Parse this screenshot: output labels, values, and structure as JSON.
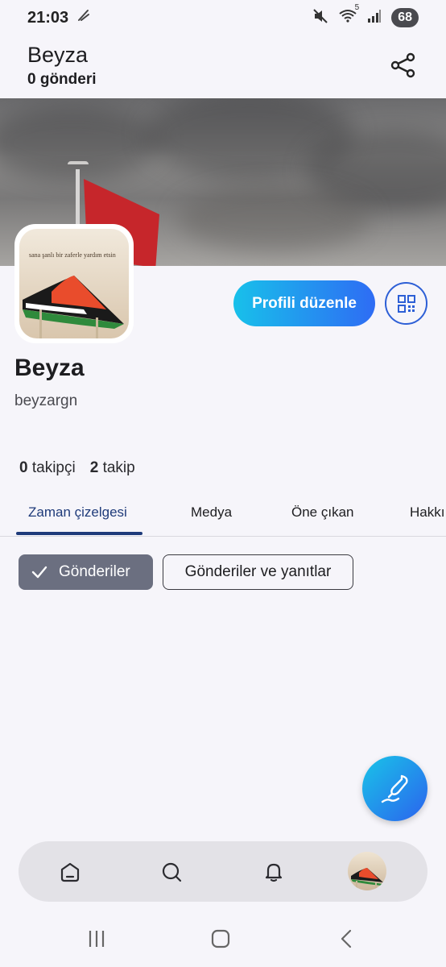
{
  "status_bar": {
    "time": "21:03",
    "battery": "68",
    "network_label": "5"
  },
  "header": {
    "name": "Beyza",
    "post_count": "0 gönderi"
  },
  "avatar": {
    "caption": "sana şanlı bir zaferle yardım etsin"
  },
  "profile": {
    "display_name": "Beyza",
    "handle": "beyzargn",
    "followers_count": "0",
    "followers_label": "takipçi",
    "following_count": "2",
    "following_label": "takip"
  },
  "actions": {
    "edit_profile": "Profili düzenle"
  },
  "tabs": [
    {
      "label": "Zaman çizelgesi"
    },
    {
      "label": "Medya"
    },
    {
      "label": "Öne çıkan"
    },
    {
      "label": "Hakkı"
    }
  ],
  "filters": {
    "posts": "Gönderiler",
    "posts_and_replies": "Gönderiler ve yanıtlar"
  },
  "colors": {
    "accent": "#2e6cf4",
    "accent_light": "#18c0ea",
    "tab_active": "#1f3b7a",
    "chip_selected": "#6b6f80",
    "flag_red": "#c6262b"
  },
  "icons": {
    "share": "share-icon",
    "qr": "qr-code-icon",
    "compose": "compose-icon",
    "home": "home-icon",
    "search": "search-icon",
    "notifications": "bell-icon"
  }
}
